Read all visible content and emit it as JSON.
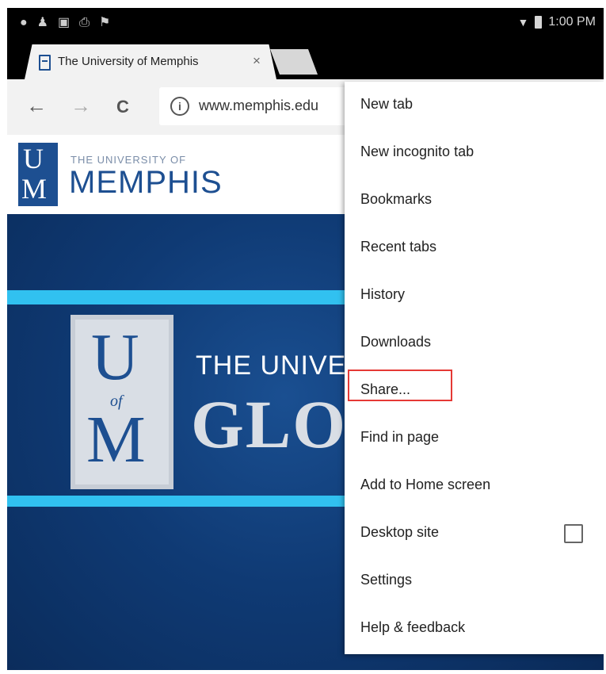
{
  "status_bar": {
    "time": "1:00 PM",
    "left_icons": [
      "notification-icon",
      "person-icon",
      "image-icon",
      "print-icon",
      "flag-icon"
    ],
    "right_icons": [
      "wifi-icon",
      "battery-icon"
    ]
  },
  "tab": {
    "title": "The University of Memphis",
    "close": "×"
  },
  "toolbar": {
    "back": "←",
    "forward": "→",
    "reload": "C",
    "info": "i",
    "url": "www.memphis.edu"
  },
  "page": {
    "logo_top": "THE UNIVERSITY OF",
    "logo_bottom": "MEMPHIS",
    "logo_mark_top": "U",
    "logo_mark_bottom": "M",
    "hero_line1": "THE UNIVERS",
    "hero_line2": "GLO",
    "crest_u": "U",
    "crest_of": "of",
    "crest_m": "M"
  },
  "menu": {
    "items": [
      {
        "label": "New tab"
      },
      {
        "label": "New incognito tab"
      },
      {
        "label": "Bookmarks"
      },
      {
        "label": "Recent tabs"
      },
      {
        "label": "History"
      },
      {
        "label": "Downloads"
      },
      {
        "label": "Share..."
      },
      {
        "label": "Find in page"
      },
      {
        "label": "Add to Home screen"
      },
      {
        "label": "Desktop site",
        "checked": false
      },
      {
        "label": "Settings"
      },
      {
        "label": "Help & feedback"
      }
    ],
    "highlighted": "Share...",
    "highlight_color": "#e53935"
  },
  "colors": {
    "brand_blue": "#1d4f91",
    "accent_cyan": "#31c1f0"
  }
}
